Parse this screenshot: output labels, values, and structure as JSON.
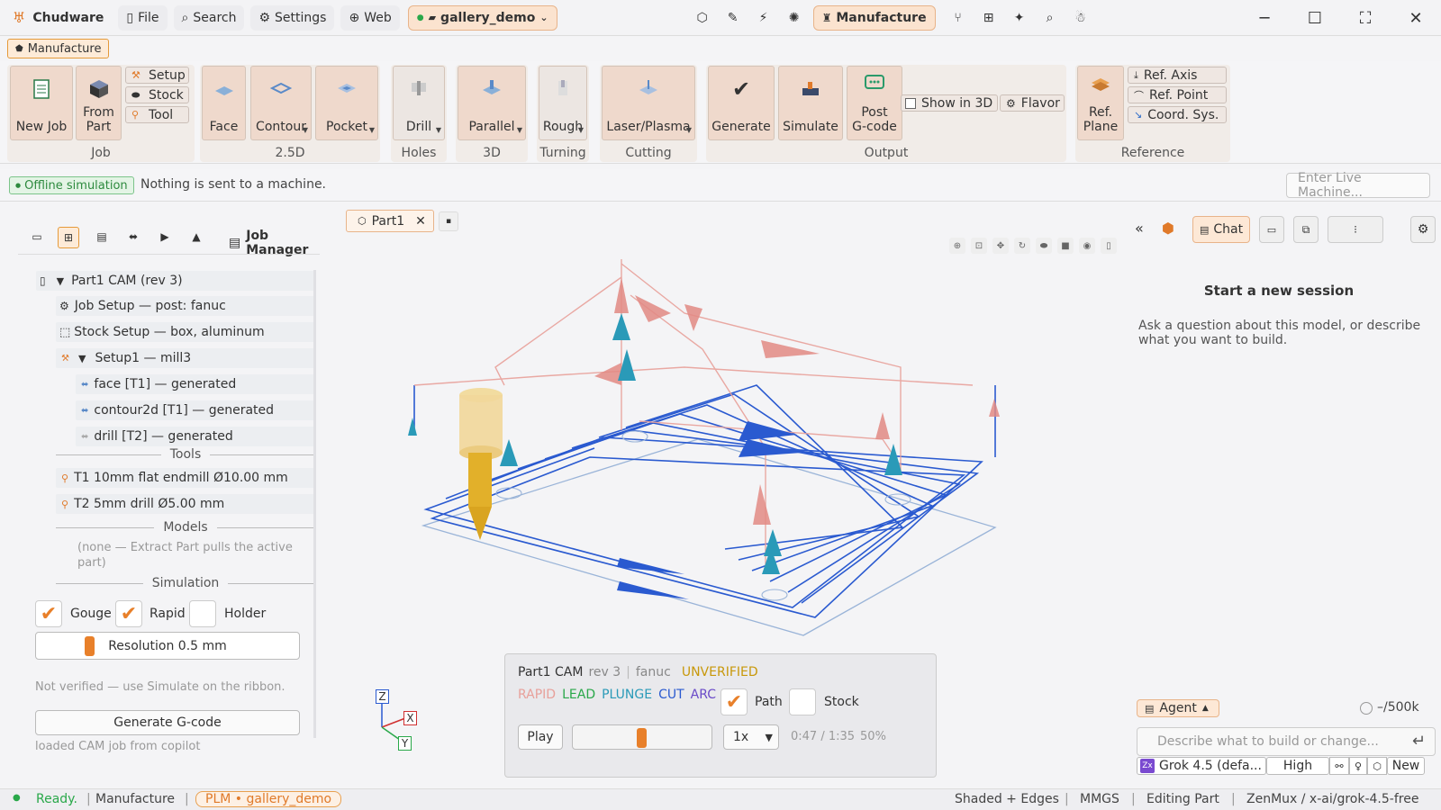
{
  "app": {
    "name": "Chudware"
  },
  "titlebar": {
    "menus": [
      {
        "label": "File",
        "icon": "file-icon"
      },
      {
        "label": "Search",
        "icon": "search-icon"
      },
      {
        "label": "Settings",
        "icon": "gear-icon"
      },
      {
        "label": "Web",
        "icon": "globe-icon"
      }
    ],
    "project": "gallery_demo",
    "workbench": "Manufacture"
  },
  "ribbon": {
    "tab": "Manufacture",
    "groups": {
      "job": {
        "label": "Job",
        "new_job": "New Job",
        "from_part": "From\nPart",
        "setup": "Setup",
        "stock": "Stock",
        "tool": "Tool"
      },
      "two_five_d": {
        "label": "2.5D",
        "face": "Face",
        "contour": "Contour",
        "pocket": "Pocket"
      },
      "holes": {
        "label": "Holes",
        "drill": "Drill"
      },
      "three_d": {
        "label": "3D",
        "parallel": "Parallel"
      },
      "turning": {
        "label": "Turning",
        "rough": "Rough"
      },
      "cutting": {
        "label": "Cutting",
        "laser": "Laser/Plasma"
      },
      "output": {
        "label": "Output",
        "generate": "Generate",
        "simulate": "Simulate",
        "post": "Post\nG-code",
        "show3d": "Show in 3D",
        "flavor": "Flavor"
      },
      "reference": {
        "label": "Reference",
        "ref_plane": "Ref.\nPlane",
        "ref_axis": "Ref. Axis",
        "ref_point": "Ref. Point",
        "coord_sys": "Coord. Sys."
      }
    }
  },
  "statusline": {
    "badge": "Offline simulation",
    "message": "Nothing is sent to a machine.",
    "live_placeholder": "Enter Live Machine..."
  },
  "doc_tab": {
    "label": "Part1"
  },
  "job_manager": {
    "title": "Job Manager",
    "tree": {
      "root": "Part1 CAM  (rev 3)",
      "job_setup": "Job Setup — post: fanuc",
      "stock_setup": "Stock Setup — box, aluminum",
      "setup1": "Setup1  —  mill3",
      "ops": [
        "face  [T1]  — generated",
        "contour2d  [T1]  — generated",
        "drill  [T2]  — generated"
      ]
    },
    "tools_label": "Tools",
    "tools": [
      "T1  10mm flat endmill  Ø10.00 mm",
      "T2  5mm drill  Ø5.00 mm"
    ],
    "models_label": "Models",
    "models_note": "(none — Extract Part pulls the active part)",
    "simulation_label": "Simulation",
    "checks": {
      "gouge": "Gouge",
      "rapid": "Rapid",
      "holder": "Holder"
    },
    "resolution": "Resolution 0.5 mm",
    "resolution_level": 0.2,
    "verify_note": "Not verified — use Simulate on the ribbon.",
    "generate_btn": "Generate G-code",
    "loaded_note": "loaded CAM job from copilot"
  },
  "viewport": {
    "axes": {
      "z": "Z",
      "x": "X",
      "y": "Y"
    },
    "toolpath_colors": {
      "rapid": "#e8a09a",
      "lead": "#2aa84a",
      "plunge": "#2a9ab8",
      "cut": "#2a5ad0",
      "arc": "#6a4ac8"
    }
  },
  "sim_panel": {
    "job": "Part1 CAM",
    "rev": "rev 3",
    "post": "fanuc",
    "status": "UNVERIFIED",
    "legend": {
      "rapid": "RAPID",
      "lead": "LEAD",
      "plunge": "PLUNGE",
      "cut": "CUT",
      "arc": "ARC"
    },
    "path_label": "Path",
    "stock_label": "Stock",
    "play": "Play",
    "speed": "1x",
    "time": "0:47 / 1:35",
    "percent": "50%",
    "progress": 0.5
  },
  "copilot": {
    "chat_tab": "Chat",
    "heading": "Start a new session",
    "subtitle": "Ask a question about this model, or describe what you want to build.",
    "mode": "Agent",
    "tokens": "–/500k",
    "input_placeholder": "Describe what to build or change...",
    "model": "Grok 4.5 (defa...",
    "effort": "High",
    "new_label": "New"
  },
  "statusbar": {
    "ready": "Ready.",
    "workbench": "Manufacture",
    "plm": "PLM • gallery_demo",
    "shading": "Shaded + Edges",
    "units": "MMGS",
    "mode": "Editing Part",
    "provider": "ZenMux  /  x-ai/grok-4.5-free"
  }
}
